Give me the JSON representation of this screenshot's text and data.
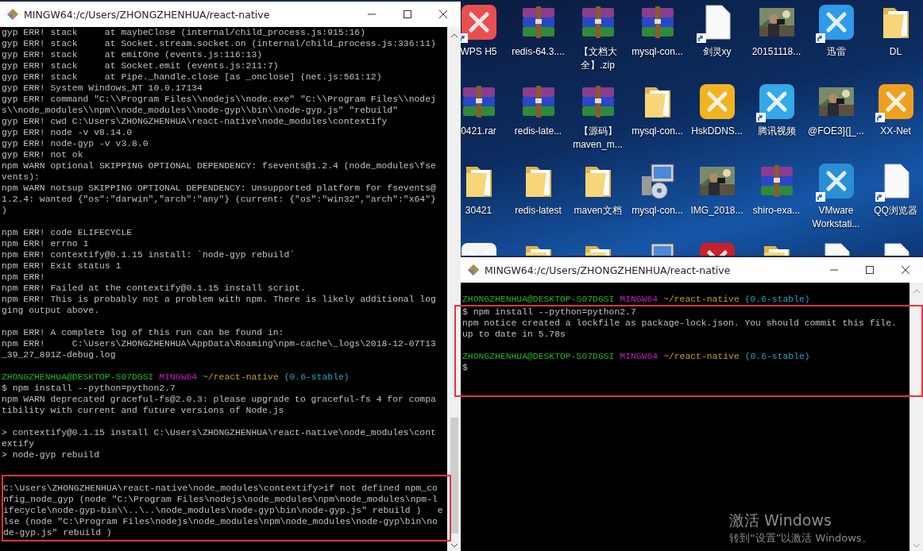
{
  "left_window": {
    "title": "MINGW64:/c/Users/ZHONGZHENHUA/react-native",
    "blocks": [
      {
        "highlighted": false,
        "lines": [
          {
            "kind": "text",
            "text": "gyp ERR! stack     at maybeClose (internal/child_process.js:915:16)"
          },
          {
            "kind": "text",
            "text": "gyp ERR! stack     at Socket.stream.socket.on (internal/child_process.js:336:11)"
          },
          {
            "kind": "text",
            "text": "gyp ERR! stack     at emitOne (events.js:116:13)"
          },
          {
            "kind": "text",
            "text": "gyp ERR! stack     at Socket.emit (events.js:211:7)"
          },
          {
            "kind": "text",
            "text": "gyp ERR! stack     at Pipe._handle.close [as _onclose] (net.js:561:12)"
          },
          {
            "kind": "text",
            "text": "gyp ERR! System Windows_NT 10.0.17134"
          },
          {
            "kind": "text",
            "text": "gyp ERR! command \"C:\\\\Program Files\\\\nodejs\\\\node.exe\" \"C:\\\\Program Files\\\\nodej"
          },
          {
            "kind": "text",
            "text": "s\\\\node_modules\\\\npm\\\\node_modules\\\\node-gyp\\\\bin\\\\node-gyp.js\" \"rebuild\""
          },
          {
            "kind": "text",
            "text": "gyp ERR! cwd C:\\Users\\ZHONGZHENHUA\\react-native\\node_modules\\contextify"
          },
          {
            "kind": "text",
            "text": "gyp ERR! node -v v8.14.0"
          },
          {
            "kind": "text",
            "text": "gyp ERR! node-gyp -v v3.8.0"
          },
          {
            "kind": "text",
            "text": "gyp ERR! not ok"
          },
          {
            "kind": "text",
            "text": "npm WARN optional SKIPPING OPTIONAL DEPENDENCY: fsevents@1.2.4 (node_modules\\fse"
          },
          {
            "kind": "text",
            "text": "vents):"
          },
          {
            "kind": "text",
            "text": "npm WARN notsup SKIPPING OPTIONAL DEPENDENCY: Unsupported platform for fsevents@"
          },
          {
            "kind": "text",
            "text": "1.2.4: wanted {\"os\":\"darwin\",\"arch\":\"any\"} (current: {\"os\":\"win32\",\"arch\":\"x64\"}"
          },
          {
            "kind": "text",
            "text": ")"
          },
          {
            "kind": "blank"
          },
          {
            "kind": "text",
            "text": "npm ERR! code ELIFECYCLE"
          },
          {
            "kind": "text",
            "text": "npm ERR! errno 1"
          },
          {
            "kind": "text",
            "text": "npm ERR! contextify@0.1.15 install: `node-gyp rebuild`"
          },
          {
            "kind": "text",
            "text": "npm ERR! Exit status 1"
          },
          {
            "kind": "text",
            "text": "npm ERR!"
          },
          {
            "kind": "text",
            "text": "npm ERR! Failed at the contextify@0.1.15 install script."
          },
          {
            "kind": "text",
            "text": "npm ERR! This is probably not a problem with npm. There is likely additional log"
          },
          {
            "kind": "text",
            "text": "ging output above."
          },
          {
            "kind": "blank"
          },
          {
            "kind": "text",
            "text": "npm ERR! A complete log of this run can be found in:"
          },
          {
            "kind": "text",
            "text": "npm ERR!     C:\\Users\\ZHONGZHENHUA\\AppData\\Roaming\\npm-cache\\_logs\\2018-12-07T13"
          },
          {
            "kind": "text",
            "text": "_39_27_891Z-debug.log"
          },
          {
            "kind": "blank"
          },
          {
            "kind": "prompt",
            "user": "ZHONGZHENHUA@DESKTOP-S07DGSI",
            "shell": "MINGW64",
            "path": "~/react-native",
            "branch": "(0.6-stable)"
          },
          {
            "kind": "text",
            "text": "$ npm install --python=python2.7"
          },
          {
            "kind": "text",
            "text": "npm WARN deprecated graceful-fs@2.0.3: please upgrade to graceful-fs 4 for compa"
          },
          {
            "kind": "text",
            "text": "tibility with current and future versions of Node.js"
          },
          {
            "kind": "blank"
          },
          {
            "kind": "text",
            "text": "> contextify@0.1.15 install C:\\Users\\ZHONGZHENHUA\\react-native\\node_modules\\cont"
          },
          {
            "kind": "text",
            "text": "extify"
          },
          {
            "kind": "text",
            "text": "> node-gyp rebuild"
          },
          {
            "kind": "blank"
          }
        ]
      },
      {
        "highlighted": true,
        "lines": [
          {
            "kind": "text",
            "text": "C:\\Users\\ZHONGZHENHUA\\react-native\\node_modules\\contextify>if not defined npm_co"
          },
          {
            "kind": "text",
            "text": "nfig_node_gyp (node \"C:\\Program Files\\nodejs\\node_modules\\npm\\node_modules\\npm-l"
          },
          {
            "kind": "text",
            "text": "ifecycle\\node-gyp-bin\\\\..\\..\\node_modules\\node-gyp\\bin\\node-gyp.js\" rebuild )   e"
          },
          {
            "kind": "text",
            "text": "lse (node \"C:\\Program Files\\nodejs\\node_modules\\npm\\node_modules\\node-gyp\\bin\\no"
          },
          {
            "kind": "text",
            "text": "de-gyp.js\" rebuild )"
          }
        ]
      }
    ]
  },
  "desktop": {
    "rows": [
      [
        {
          "label": "WPS H5",
          "kind": "app",
          "color": "#e8504f",
          "shortcut": true
        },
        {
          "label": "redis-64.3....",
          "kind": "archive",
          "shortcut": false
        },
        {
          "label": "【文档大全】.zip",
          "kind": "archive",
          "shortcut": false
        },
        {
          "label": "mysql-con...",
          "kind": "archive",
          "shortcut": false
        },
        {
          "label": "剑灵xy",
          "kind": "file",
          "shortcut": true
        },
        {
          "label": "20151118...",
          "kind": "picture",
          "shortcut": false
        },
        {
          "label": "迅雷",
          "kind": "app",
          "color": "#2f9ae8",
          "shortcut": true
        },
        {
          "label": "DL",
          "kind": "folder",
          "shortcut": false
        }
      ],
      [
        {
          "label": "0421.rar",
          "kind": "archive",
          "shortcut": false
        },
        {
          "label": "redis-late...",
          "kind": "archive",
          "shortcut": false
        },
        {
          "label": "【源码】maven_m...",
          "kind": "archive",
          "shortcut": false
        },
        {
          "label": "mysql-con...",
          "kind": "folder",
          "shortcut": false
        },
        {
          "label": "HskDDNS...",
          "kind": "app",
          "color": "#f2b323",
          "shortcut": false
        },
        {
          "label": "腾讯视频",
          "kind": "app",
          "color": "#35a8e8",
          "shortcut": true
        },
        {
          "label": "@FOE3]{]_...",
          "kind": "picture",
          "shortcut": false
        },
        {
          "label": "XX-Net",
          "kind": "app",
          "color": "#f0a020",
          "shortcut": true
        }
      ],
      [
        {
          "label": "30421",
          "kind": "folder",
          "shortcut": false
        },
        {
          "label": "redis-latest",
          "kind": "folder",
          "shortcut": false
        },
        {
          "label": "maven文档",
          "kind": "folder",
          "shortcut": false
        },
        {
          "label": "mysql-con...",
          "kind": "installer",
          "shortcut": false
        },
        {
          "label": "IMG_2018...",
          "kind": "picture",
          "shortcut": false
        },
        {
          "label": "shiro-exa...",
          "kind": "archive",
          "shortcut": false
        },
        {
          "label": "VMware Workstati...",
          "kind": "app",
          "color": "#2b8fd6",
          "shortcut": true
        },
        {
          "label": "QQ浏览器",
          "kind": "file",
          "shortcut": true
        }
      ],
      [
        {
          "kind": "app",
          "color": "#f4f4f4",
          "shortcut": false
        },
        {
          "kind": "folder",
          "shortcut": false
        },
        {
          "kind": "folder",
          "shortcut": false
        },
        {
          "kind": "installer",
          "shortcut": false
        },
        {
          "kind": "app",
          "color": "#c8202a",
          "shortcut": false
        },
        {
          "kind": "folder",
          "shortcut": false
        },
        {
          "kind": "file",
          "shortcut": false
        },
        {
          "kind": "file",
          "shortcut": false
        }
      ]
    ]
  },
  "right_window": {
    "title": "MINGW64:/c/Users/ZHONGZHENHUA/react-native",
    "blocks": [
      {
        "highlighted": false,
        "lines": [
          {
            "kind": "blank"
          },
          {
            "kind": "prompt",
            "user": "ZHONGZHENHUA@DESKTOP-S07DGSI",
            "shell": "MINGW64",
            "path": "~/react-native",
            "branch": "(0.6-stable)"
          }
        ]
      },
      {
        "highlighted": true,
        "lines": [
          {
            "kind": "text",
            "text": "$ npm install --python=python2.7"
          },
          {
            "kind": "text",
            "text": "npm notice created a lockfile as package-lock.json. You should commit this file."
          },
          {
            "kind": "text",
            "text": "up to date in 5.78s"
          },
          {
            "kind": "blank"
          },
          {
            "kind": "prompt",
            "user": "ZHONGZHENHUA@DESKTOP-S07DGSI",
            "shell": "MINGW64",
            "path": "~/react-native",
            "branch": "(0.6-stable)"
          },
          {
            "kind": "text",
            "text": "$"
          },
          {
            "kind": "blank"
          },
          {
            "kind": "blank"
          }
        ]
      }
    ]
  },
  "activation_notice": {
    "title": "激活 Windows",
    "hint": "转到“设置”以激活 Windows。"
  }
}
